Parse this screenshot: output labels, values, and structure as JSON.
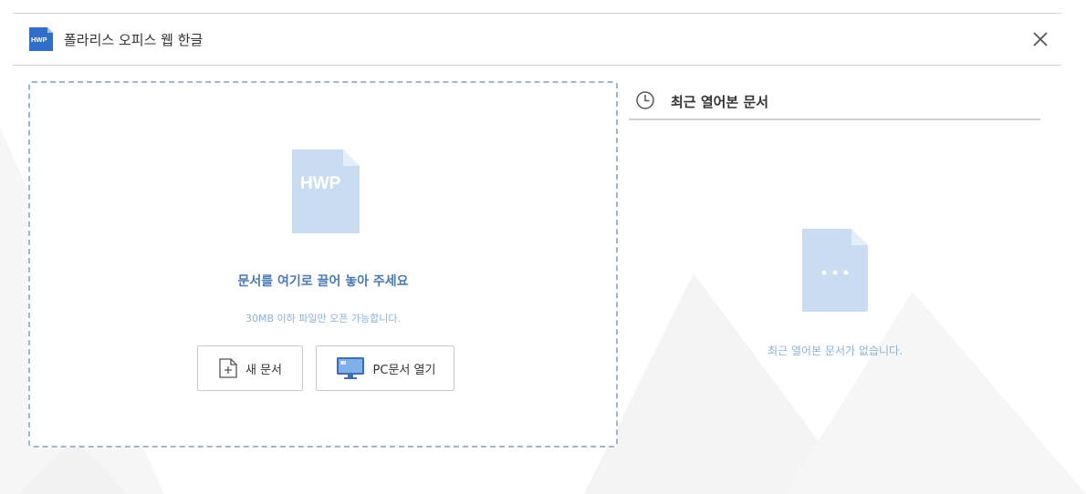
{
  "header": {
    "logo_text": "HWP",
    "title": "폴라리스 오피스 웹 한글"
  },
  "drop_zone": {
    "file_badge": "HWP",
    "title": "문서를 여기로 끌어 놓아 주세요",
    "subtitle": "30MB 이하 파일만 오픈 가능합니다.",
    "new_doc_label": "새 문서",
    "open_pc_label": "PC문서 열기"
  },
  "recent": {
    "title": "최근 열어본 문서",
    "empty_message": "최근 열어본 문서가 없습니다."
  },
  "colors": {
    "accent_blue": "#4a7ab3",
    "light_blue": "#8ab2d8",
    "file_fill": "#c9dcf2",
    "logo_blue": "#2f6fc9"
  }
}
